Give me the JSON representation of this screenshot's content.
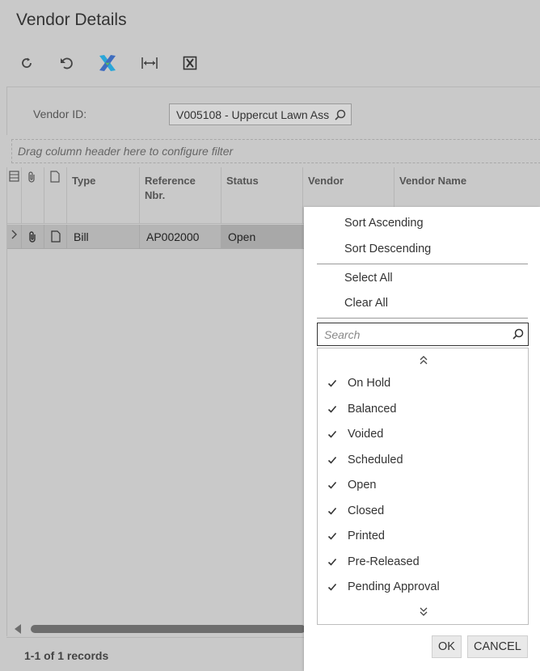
{
  "page": {
    "title": "Vendor Details"
  },
  "toolbar": {
    "buttons": [
      {
        "icon": "refresh-icon"
      },
      {
        "icon": "undo-icon"
      },
      {
        "icon": "colorful-x-icon"
      },
      {
        "icon": "fit-width-icon"
      },
      {
        "icon": "export-excel-icon"
      }
    ]
  },
  "vendor": {
    "label": "Vendor ID:",
    "value": "V005108 - Uppercut Lawn Ass"
  },
  "grid": {
    "filter_hint": "Drag column header here to configure filter",
    "columns": [
      "Type",
      "Reference Nbr.",
      "Status",
      "Vendor",
      "Vendor Name"
    ],
    "rows": [
      {
        "type": "Bill",
        "reference_nbr": "AP002000",
        "status": "Open"
      }
    ],
    "records": "1-1 of 1 records"
  },
  "dropdown": {
    "sort_ascending": "Sort Ascending",
    "sort_descending": "Sort Descending",
    "select_all": "Select All",
    "clear_all": "Clear All",
    "search_placeholder": "Search",
    "items": [
      {
        "label": "On Hold",
        "checked": true
      },
      {
        "label": "Balanced",
        "checked": true
      },
      {
        "label": "Voided",
        "checked": true
      },
      {
        "label": "Scheduled",
        "checked": true
      },
      {
        "label": "Open",
        "checked": true
      },
      {
        "label": "Closed",
        "checked": true
      },
      {
        "label": "Printed",
        "checked": true
      },
      {
        "label": "Pre-Released",
        "checked": true
      },
      {
        "label": "Pending Approval",
        "checked": true
      }
    ],
    "ok": "OK",
    "cancel": "CANCEL"
  }
}
